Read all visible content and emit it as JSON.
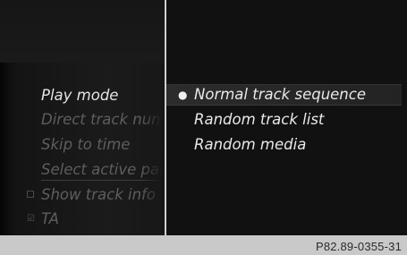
{
  "left_menu": {
    "items": [
      {
        "label": "Play mode",
        "state": "active"
      },
      {
        "label": "Direct track number",
        "state": "inactive"
      },
      {
        "label": "Skip to time",
        "state": "inactive"
      },
      {
        "label": "Select active partition",
        "state": "inactive"
      },
      {
        "label": "Show track info",
        "state": "inactive",
        "checkbox": "unchecked"
      },
      {
        "label": "TA",
        "state": "inactive",
        "checkbox": "checked"
      }
    ]
  },
  "right_menu": {
    "options": [
      {
        "label": "Normal track sequence",
        "selected": true
      },
      {
        "label": "Random track list",
        "selected": false
      },
      {
        "label": "Random media",
        "selected": false
      }
    ]
  },
  "icons": {
    "selected_marker": "bullet-icon",
    "unchecked": "checkbox-empty-icon",
    "checked": "checkbox-checked-icon"
  },
  "caption": {
    "text": "P82.89-0355-31"
  },
  "colors": {
    "screen_bg": "#121212",
    "active_text": "#e4e4e4",
    "inactive_text": "#5e5e5e",
    "divider": "#cfcfcf",
    "caption_bar": "#c9c9c9"
  }
}
